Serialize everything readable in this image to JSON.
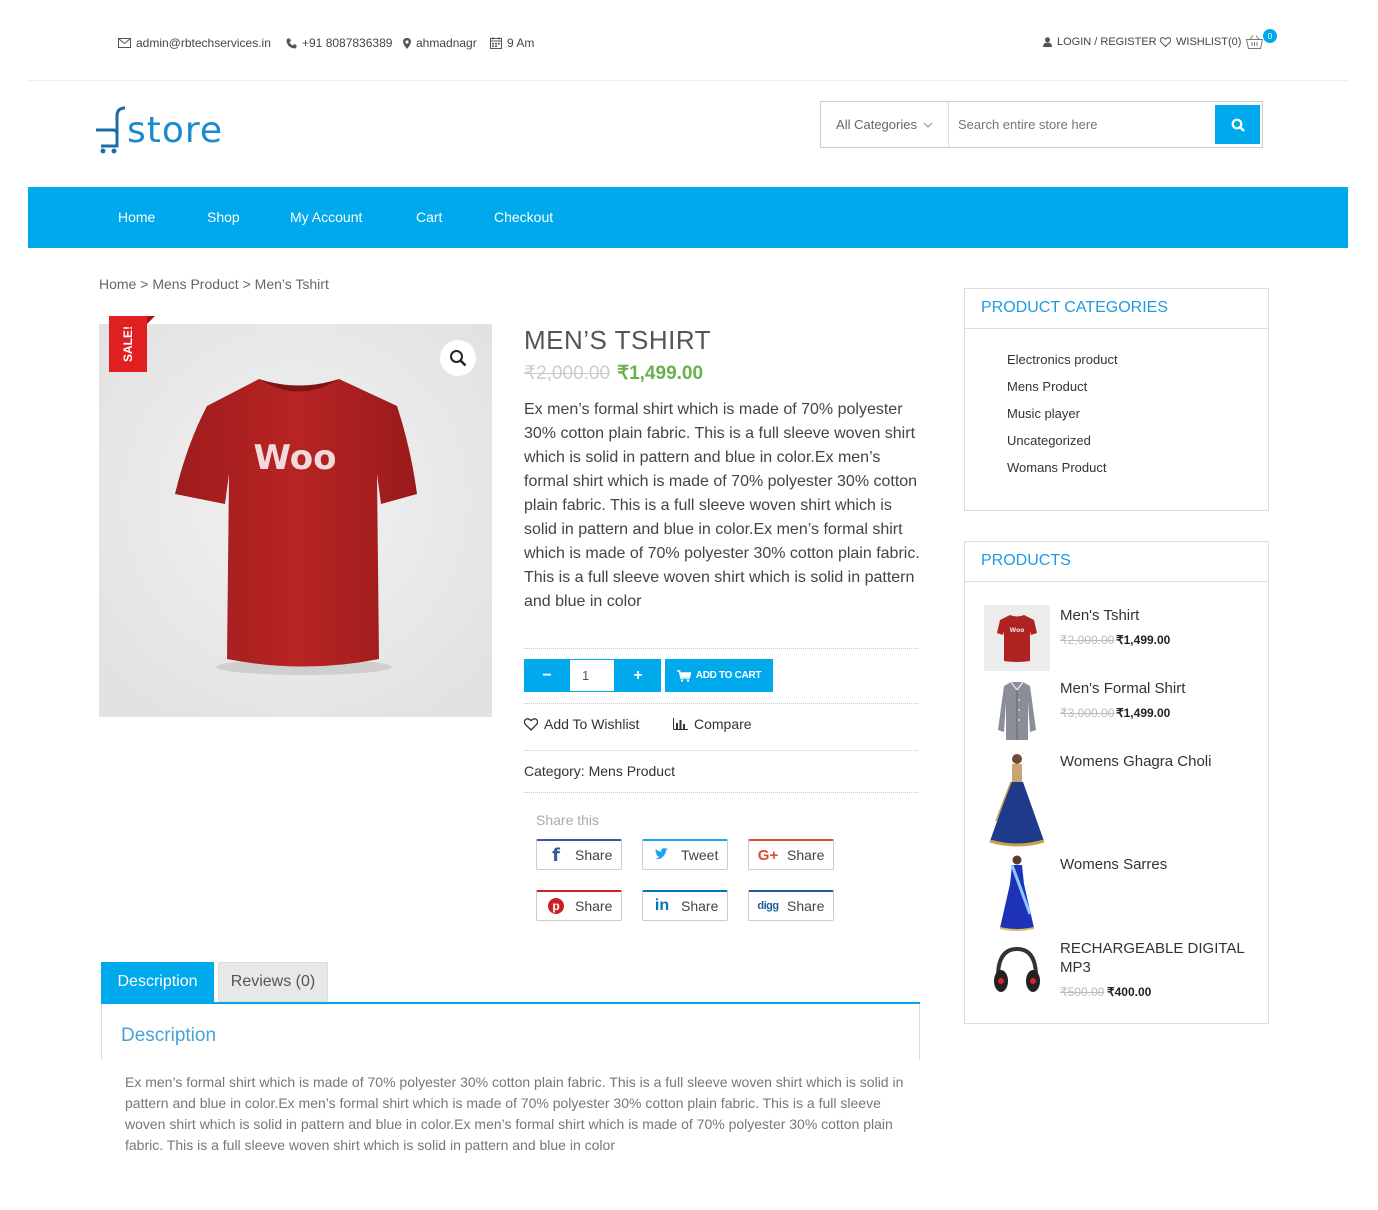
{
  "topbar": {
    "email": "admin@rbtechservices.in",
    "phone": "+91 8087836389",
    "location": "ahmadnagr",
    "hours": "9 Am",
    "login": "LOGIN / REGISTER",
    "wishlist": "WISHLIST(0)",
    "cart_count": "0"
  },
  "logo": {
    "text": "store"
  },
  "search": {
    "category": "All Categories",
    "placeholder": "Search entire store here"
  },
  "nav": {
    "items": [
      "Home",
      "Shop",
      "My Account",
      "Cart",
      "Checkout"
    ]
  },
  "breadcrumb": {
    "home": "Home",
    "sep1": ">",
    "cat": "Mens Product",
    "sep2": ">",
    "current": "Men’s Tshirt"
  },
  "product": {
    "sale_badge": "SALE!",
    "image_text": "Woo",
    "title": "MEN’S TSHIRT",
    "old_price": "₹2,000.00",
    "price": "₹1,499.00",
    "description": "Ex men’s formal shirt which is made of 70% polyester 30% cotton plain fabric. This is a full sleeve woven shirt which is solid in pattern and blue in color.Ex men’s formal shirt which is made of 70% polyester 30% cotton plain fabric. This is a full sleeve woven shirt which is solid in pattern and blue in color.Ex men’s formal shirt which is made of 70% polyester 30% cotton plain fabric. This is a full sleeve woven shirt which is solid in pattern and blue in color",
    "qty": "1",
    "minus": "−",
    "plus": "+",
    "add_to_cart": "ADD TO CART",
    "wishlist": "Add To Wishlist",
    "compare": "Compare",
    "category_label": "Category:",
    "category_value": "Mens Product"
  },
  "share": {
    "title": "Share this",
    "buttons": [
      {
        "network": "facebook",
        "label": "Share"
      },
      {
        "network": "twitter",
        "label": "Tweet"
      },
      {
        "network": "google-plus",
        "label": "Share"
      },
      {
        "network": "pinterest",
        "label": "Share"
      },
      {
        "network": "linkedin",
        "label": "Share"
      },
      {
        "network": "digg",
        "label": "Share"
      }
    ]
  },
  "tabs": {
    "items": [
      "Description",
      "Reviews (0)"
    ],
    "panel_title": "Description",
    "panel_text": "Ex men’s formal shirt which is made of 70% polyester 30% cotton plain fabric. This is a full sleeve woven shirt which is solid in pattern and blue in color.Ex men’s formal shirt which is made of 70% polyester 30% cotton plain fabric. This is a full sleeve woven shirt which is solid in pattern and blue in color.Ex men’s formal shirt which is made of 70% polyester 30% cotton plain fabric. This is a full sleeve woven shirt which is solid in pattern and blue in color"
  },
  "sidebar": {
    "categories_title": "PRODUCT CATEGORIES",
    "categories": [
      "Electronics product",
      "Mens Product",
      "Music player",
      "Uncategorized",
      "Womans Product"
    ],
    "products_title": "PRODUCTS",
    "products": [
      {
        "name": "Men's Tshirt",
        "old_price": "₹2,000.00",
        "price": "₹1,499.00"
      },
      {
        "name": "Men's Formal Shirt",
        "old_price": "₹3,000.00",
        "price": "₹1,499.00"
      },
      {
        "name": "Womens Ghagra Choli"
      },
      {
        "name": "Womens Sarres"
      },
      {
        "name": "RECHARGEABLE DIGITAL MP3",
        "old_price": "₹500.00",
        "price": "₹400.00"
      }
    ]
  },
  "colors": {
    "accent": "#00a8ec",
    "sale": "#e02020",
    "price_green": "#6ab04c"
  }
}
